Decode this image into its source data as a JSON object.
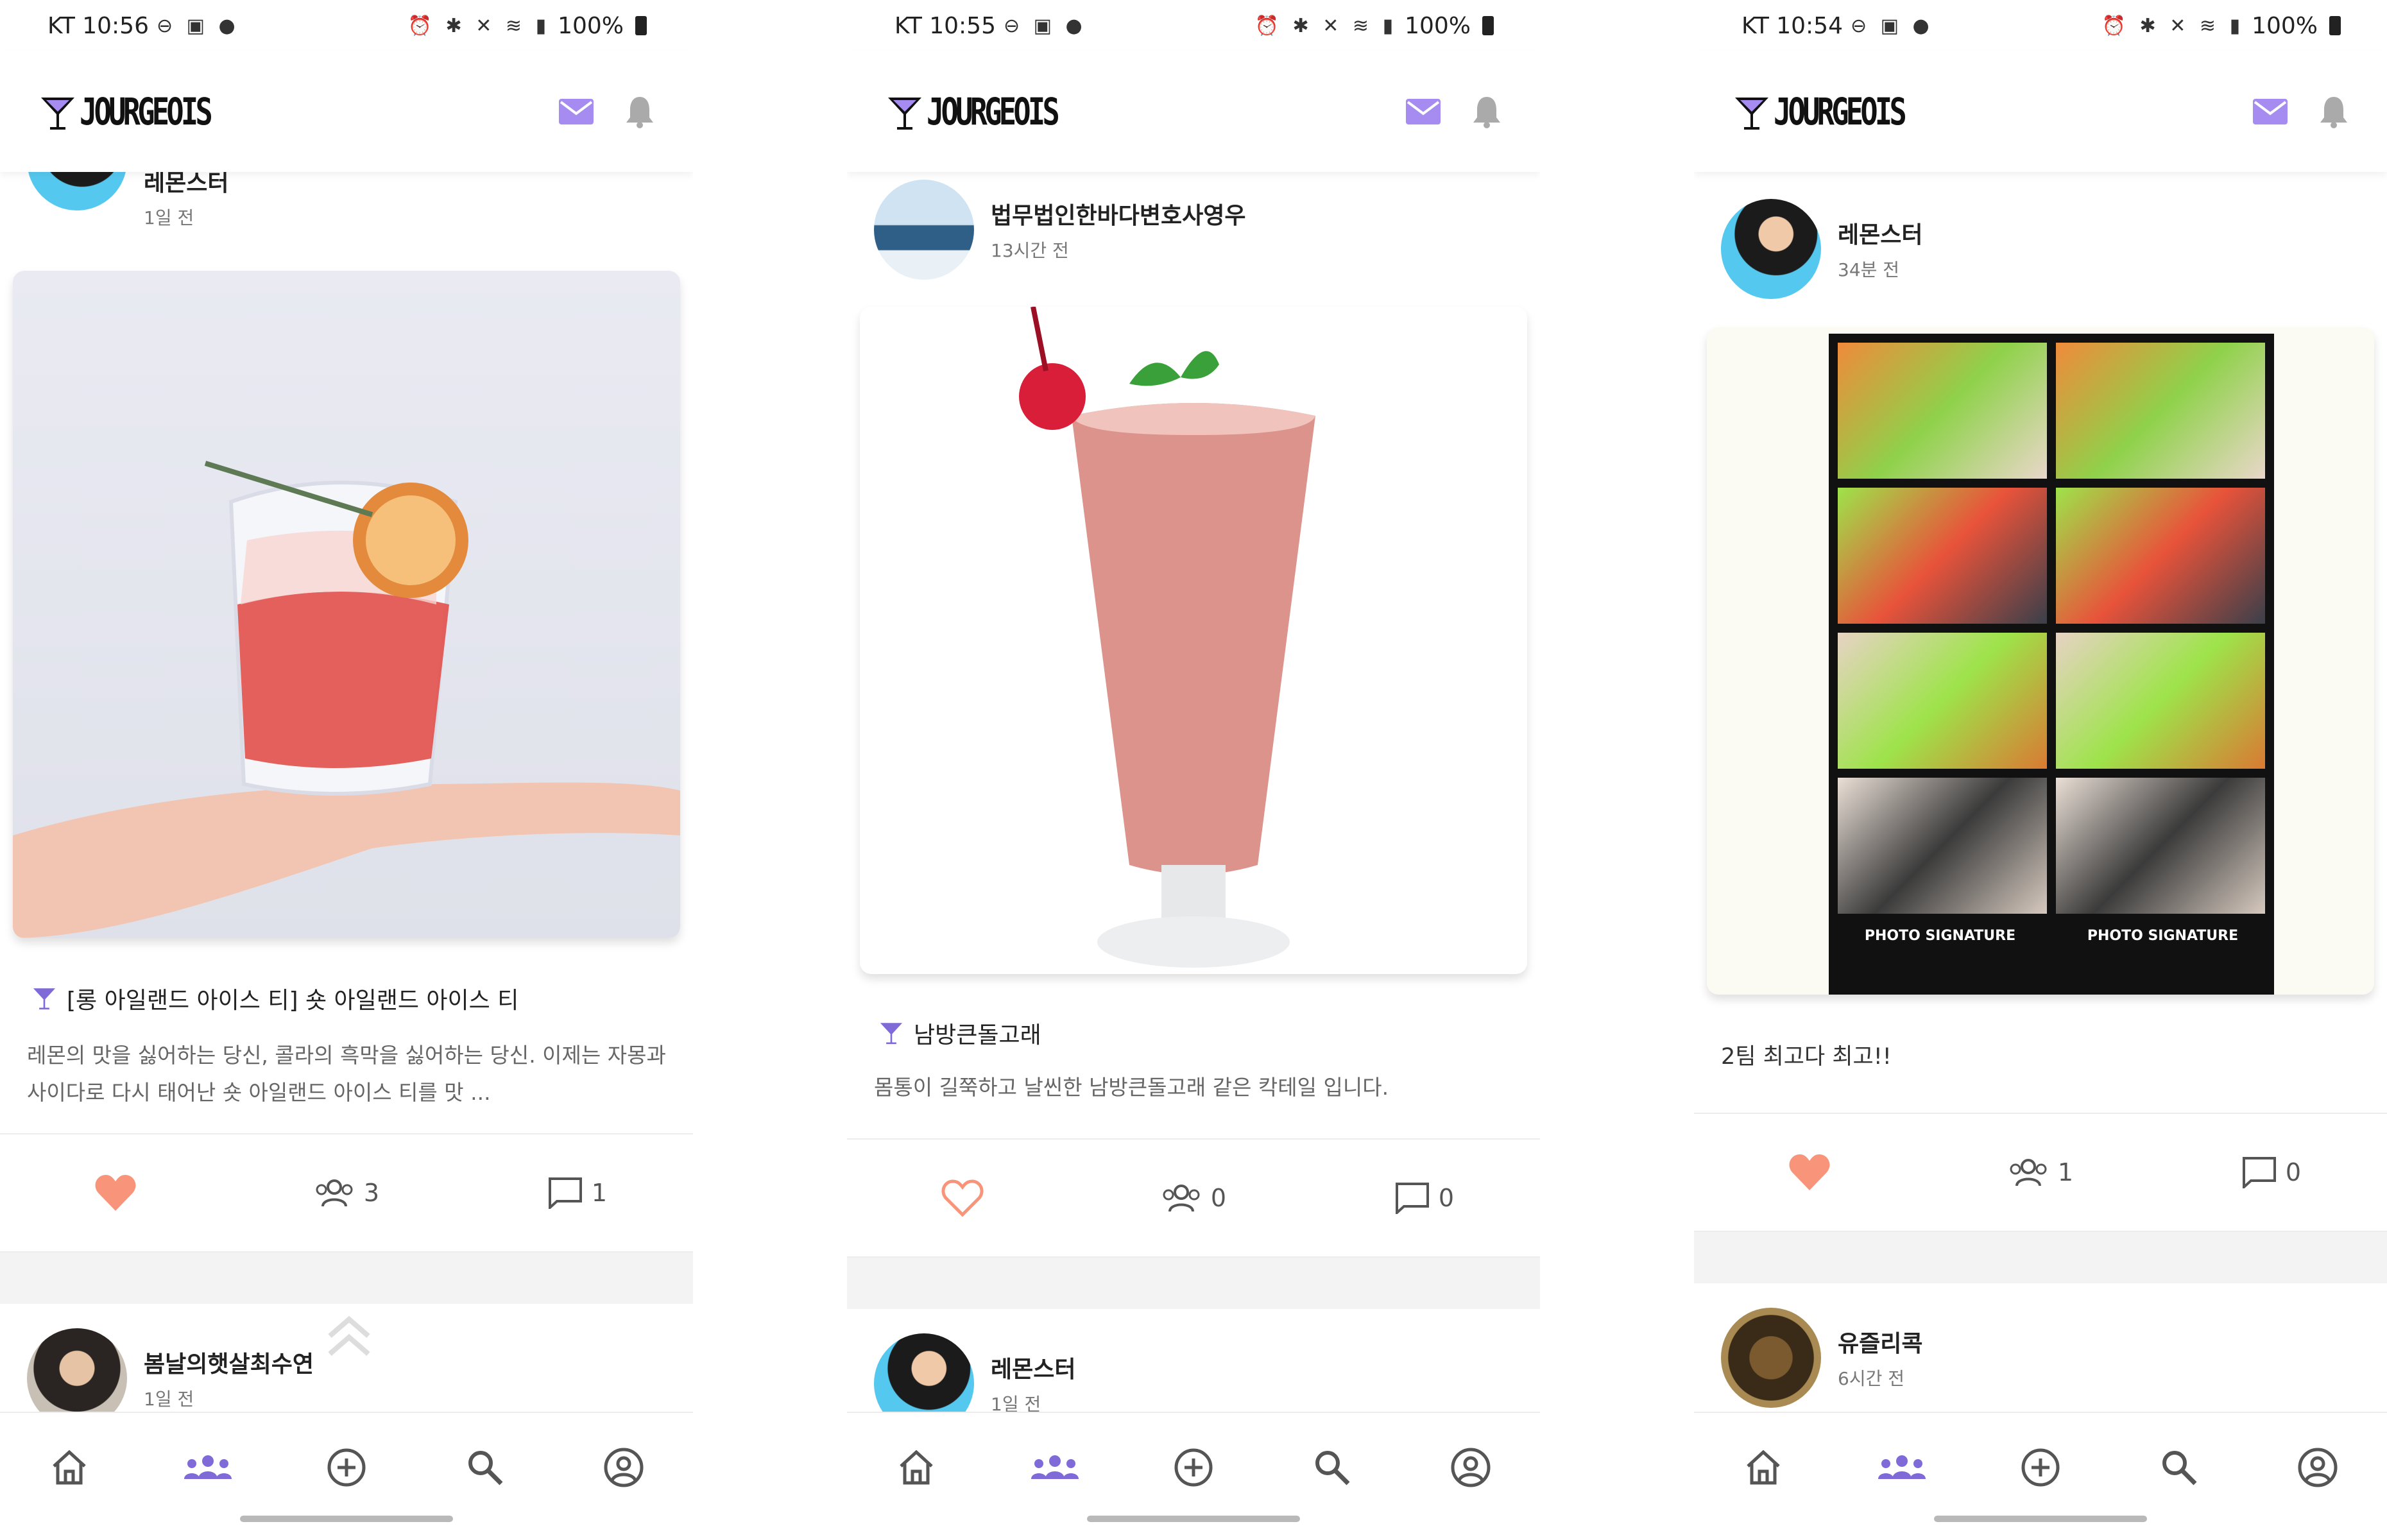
{
  "theme": {
    "accent": "#a68cf0",
    "heart": "#f8947a",
    "app_name": "JOURGEOIS"
  },
  "screens": [
    {
      "status": {
        "carrier_time": "KT 10:56",
        "battery": "100%"
      },
      "post": {
        "author": "레몬스터",
        "time": "1일 전",
        "title": "[롱 아일랜드 아이스 티] 숏 아일랜드 아이스 티",
        "desc": "레몬의 맛을 싫어하는 당신, 콜라의 흑막을 싫어하는 당신. 이제는 자몽과 사이다로 다시 태어난 숏 아일랜드 아이스 티를 맛 ...",
        "likes_filled": true,
        "participants": "3",
        "comments": "1"
      },
      "next_post": {
        "author": "봄날의햇살최수연",
        "time": "1일 전"
      }
    },
    {
      "status": {
        "carrier_time": "KT 10:55",
        "battery": "100%"
      },
      "post": {
        "author": "법무법인한바다변호사영우",
        "time": "13시간 전",
        "title": "남방큰돌고래",
        "desc": "몸통이 길쭉하고 날씬한 남방큰돌고래 같은 칵테일 입니다.",
        "likes_filled": false,
        "participants": "0",
        "comments": "0"
      },
      "next_post": {
        "author": "레몬스터",
        "time": "1일 전"
      }
    },
    {
      "status": {
        "carrier_time": "KT 10:54",
        "battery": "100%"
      },
      "post": {
        "author": "레몬스터",
        "time": "34분 전",
        "title": "",
        "desc": "2팀 최고다 최고!!",
        "likes_filled": true,
        "participants": "1",
        "comments": "0",
        "photo_caption": "PHOTO SIGNATURE"
      },
      "next_post": {
        "author": "유즐리콕",
        "time": "6시간 전"
      }
    }
  ],
  "nav": {
    "items": [
      "home-icon",
      "community-icon",
      "add-icon",
      "search-icon",
      "profile-icon"
    ],
    "active": "community-icon"
  }
}
